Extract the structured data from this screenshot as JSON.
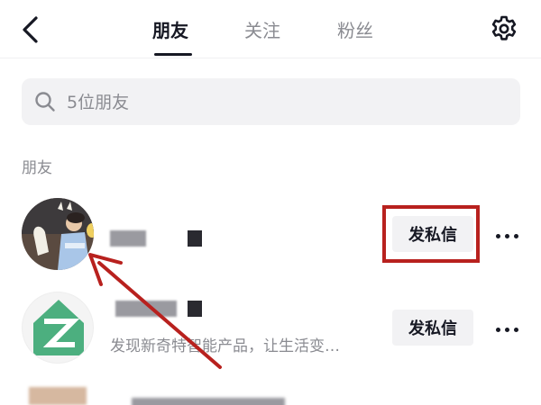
{
  "header": {
    "tabs": [
      {
        "label": "朋友",
        "active": true
      },
      {
        "label": "关注",
        "active": false
      },
      {
        "label": "粉丝",
        "active": false
      }
    ],
    "back_icon": "chevron-left-icon",
    "settings_icon": "gear-icon"
  },
  "search": {
    "placeholder": "5位朋友",
    "value": "",
    "icon": "search-icon"
  },
  "section_title": "朋友",
  "friends": [
    {
      "name_visible": false,
      "subtitle": "",
      "dm_label": "发私信",
      "highlighted": true,
      "avatar": "child-photo"
    },
    {
      "name_visible": false,
      "subtitle": "发现新奇特智能产品，让生活变…",
      "dm_label": "发私信",
      "highlighted": false,
      "avatar": "green-z-logo"
    },
    {
      "name_visible": false,
      "subtitle": "",
      "dm_label": "",
      "highlighted": false,
      "avatar": "blurred"
    }
  ],
  "colors": {
    "accent_text": "#161823",
    "muted_text": "#8a8b91",
    "button_bg": "#f2f2f4",
    "annotation_red": "#b8211e",
    "logo_green": "#4caf7f"
  }
}
